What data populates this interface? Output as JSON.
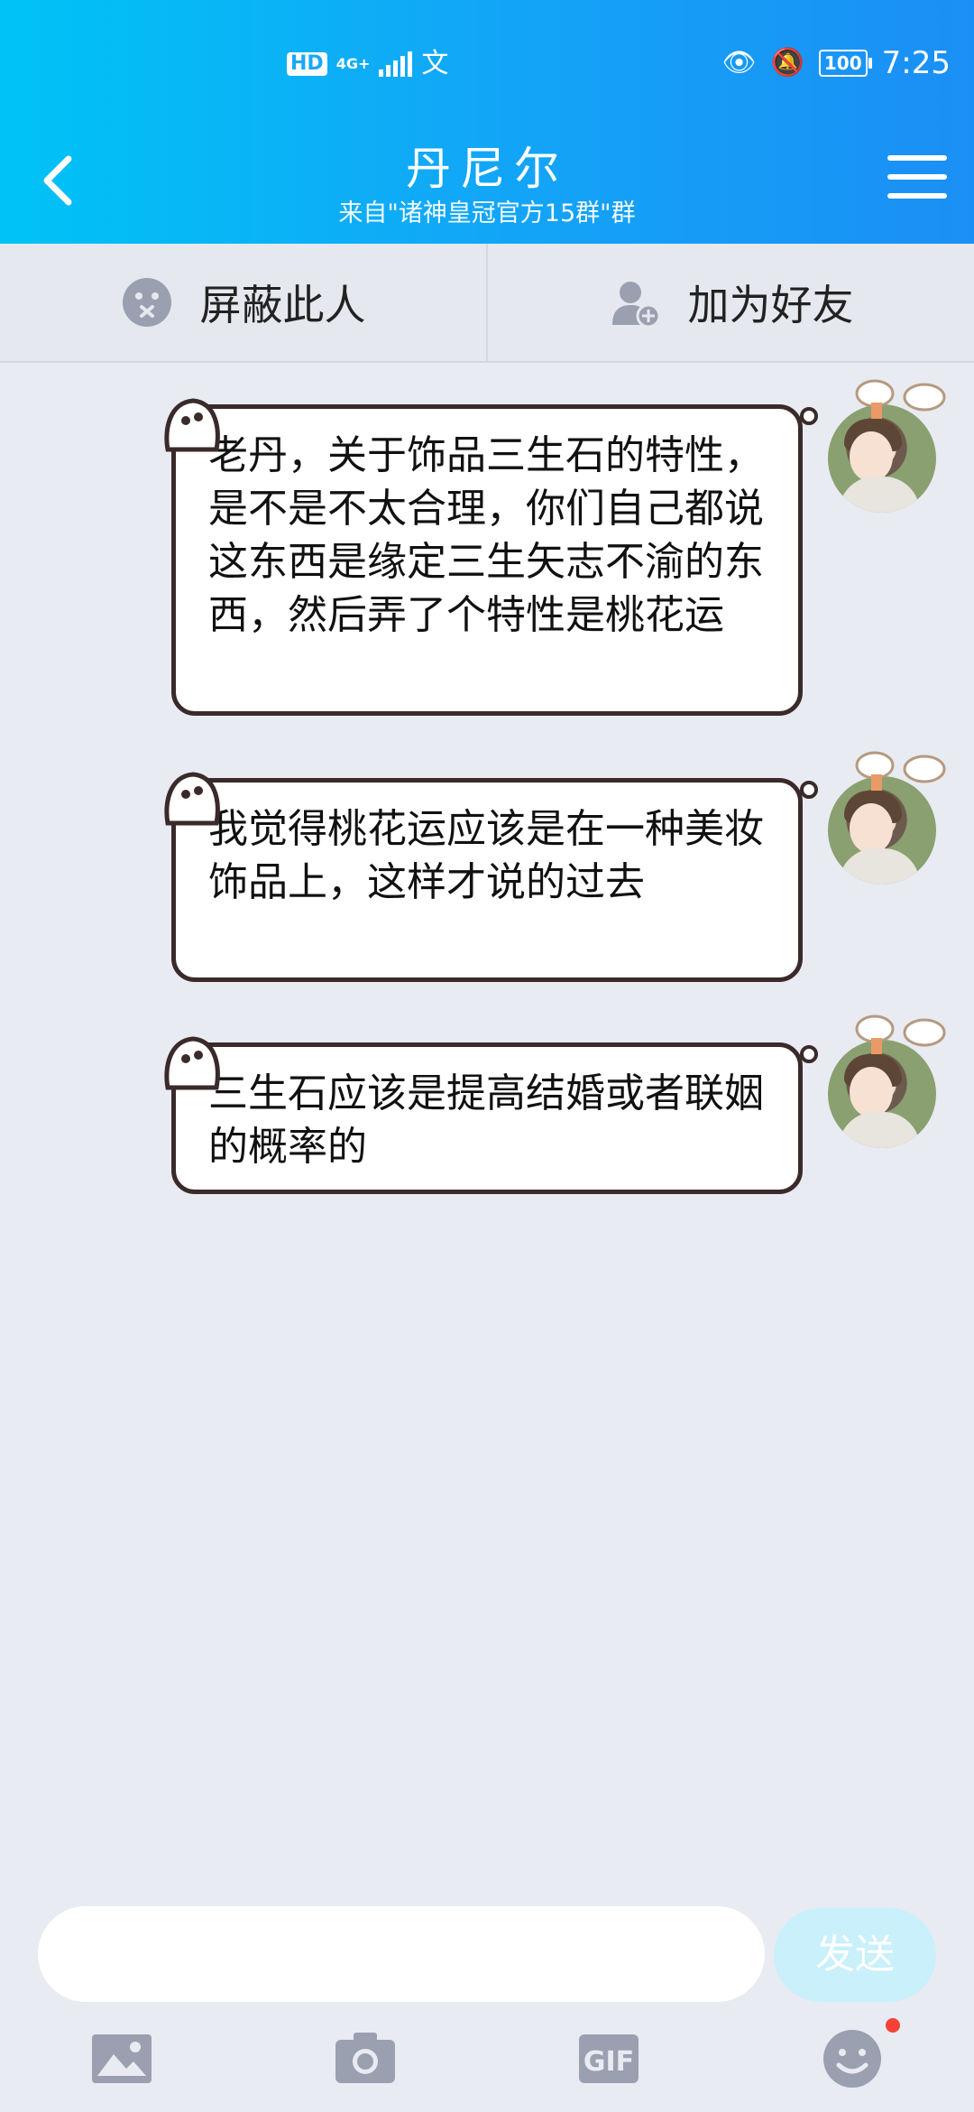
{
  "status_bar": {
    "hd": "HD",
    "network": "4G+",
    "time": "7:25",
    "battery": "100"
  },
  "header": {
    "title": "丹尼尔",
    "subtitle": "来自\"诸神皇冠官方15群\"群"
  },
  "actions": [
    {
      "label": "屏蔽此人",
      "icon": "block-face-icon"
    },
    {
      "label": "加为好友",
      "icon": "add-friend-icon"
    }
  ],
  "messages": [
    {
      "text": "老丹，关于饰品三生石的特性，是不是不太合理，你们自己都说这东西是缘定三生矢志不渝的东西，然后弄了个特性是桃花运"
    },
    {
      "text": "我觉得桃花运应该是在一种美妆饰品上，这样才说的过去"
    },
    {
      "text": "三生石应该是提高结婚或者联姻的概率的"
    }
  ],
  "composer": {
    "input_value": "",
    "send_label": "发送"
  },
  "toolbar": [
    "image-icon",
    "camera-icon",
    "gif-icon",
    "emoji-icon"
  ],
  "colors": {
    "header_start": "#00c3f5",
    "header_end": "#1b8ff5",
    "background": "#e9ebf2",
    "send_button": "#c9f0fb",
    "notification_dot": "#f44336"
  }
}
